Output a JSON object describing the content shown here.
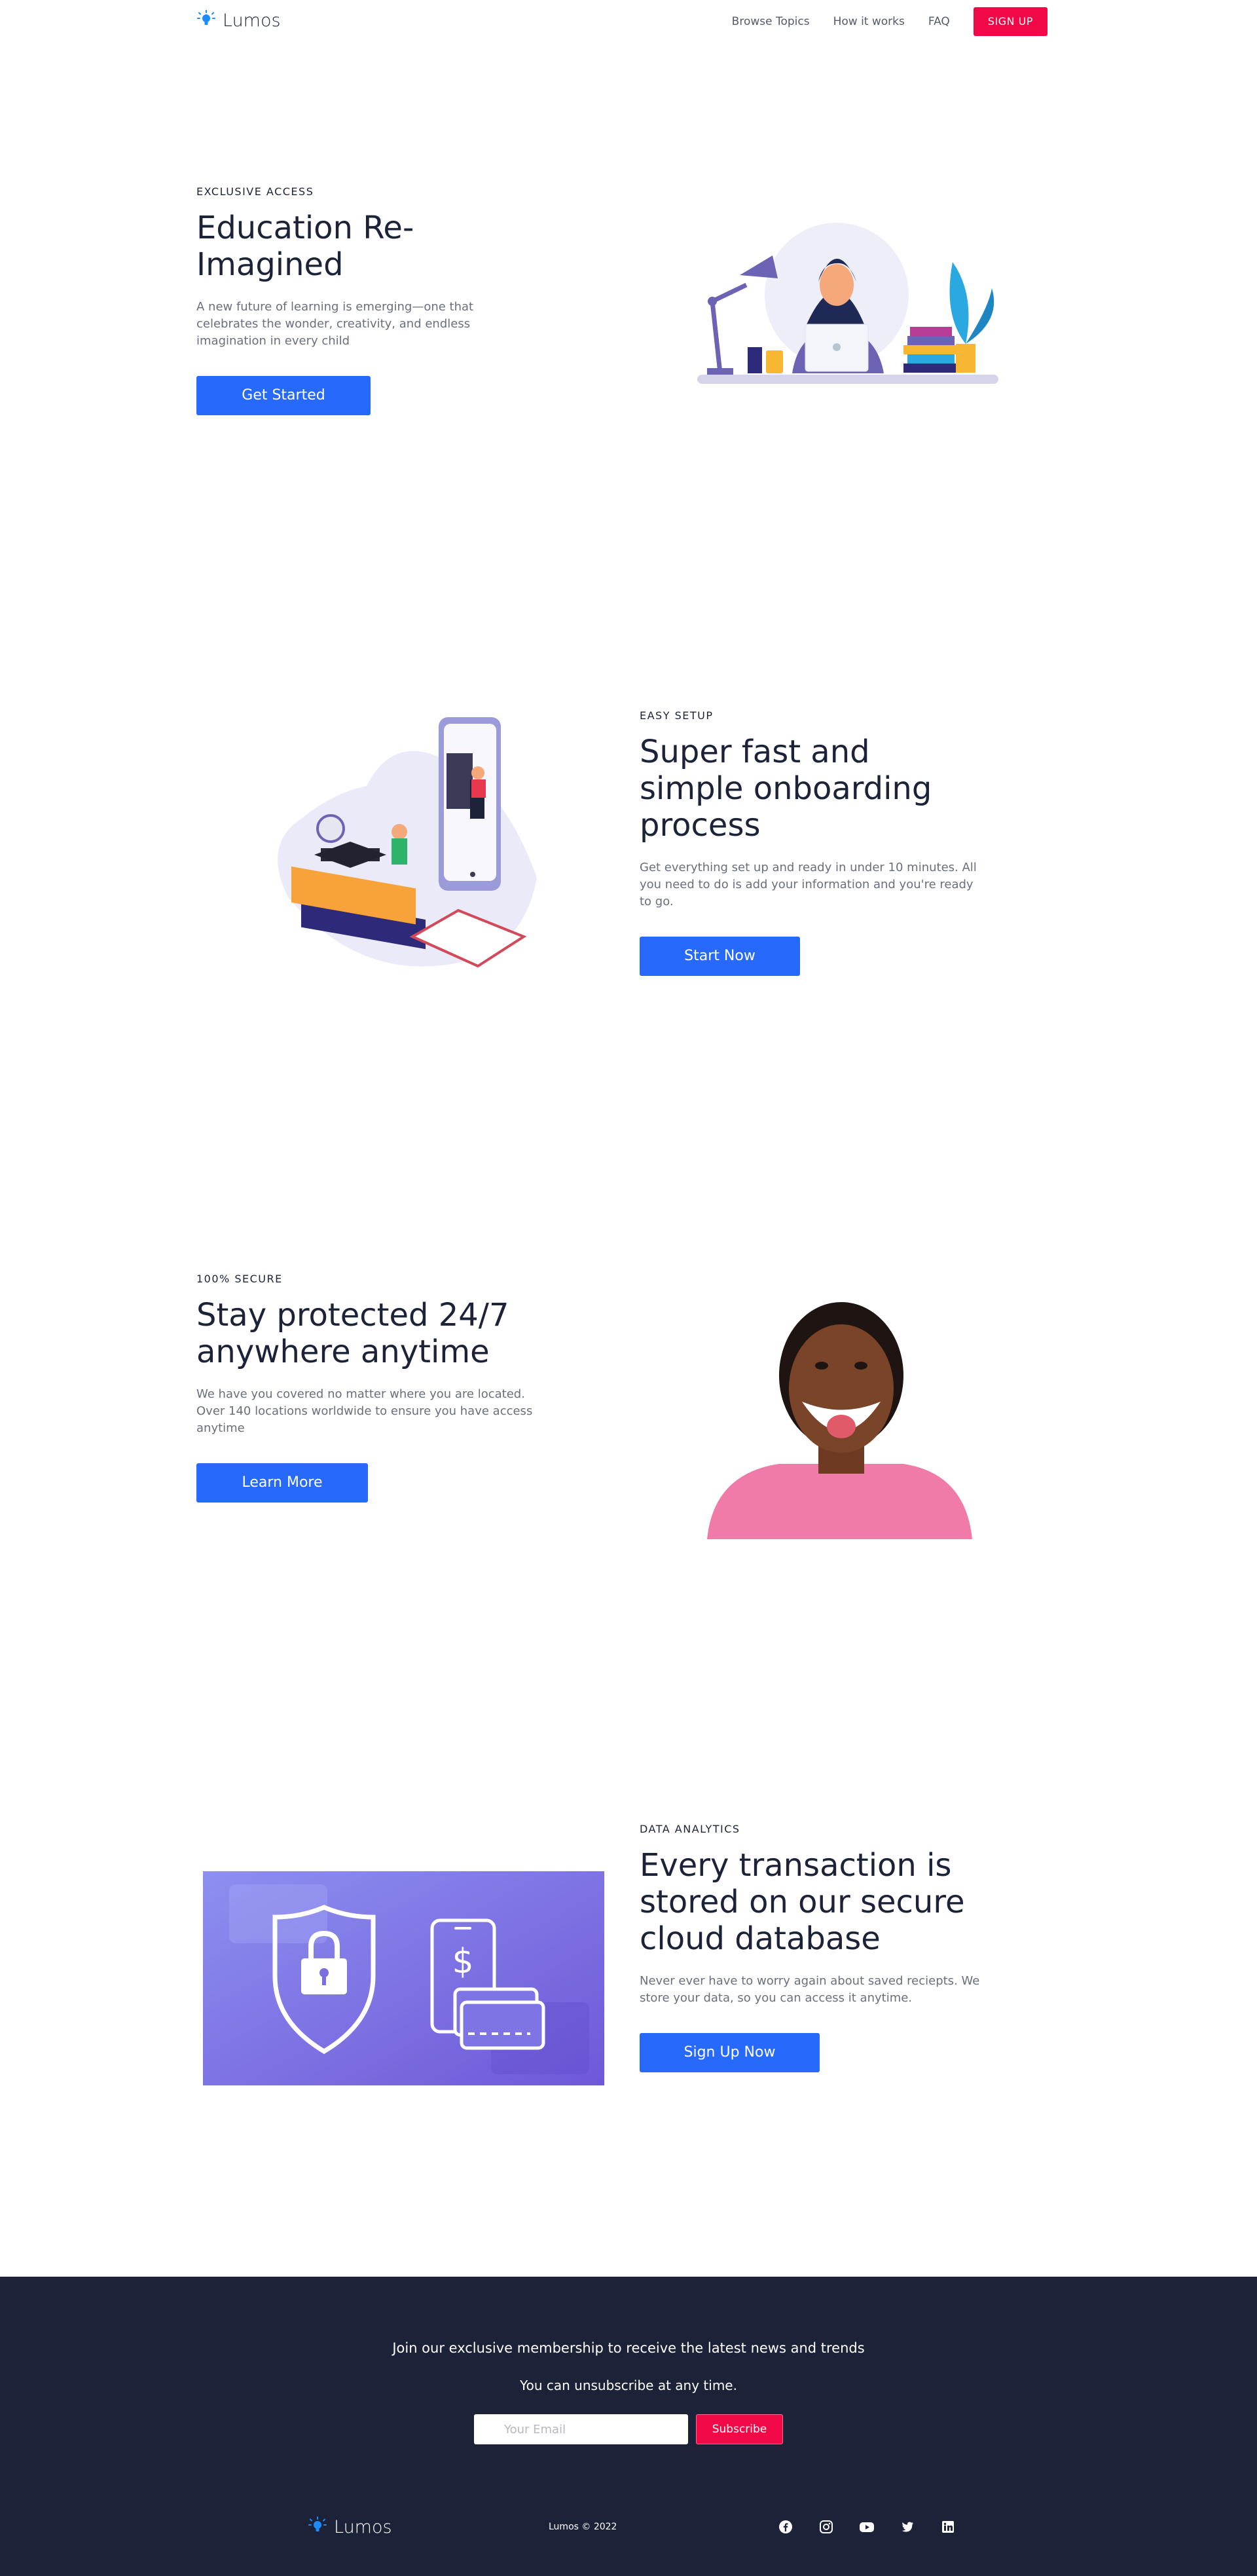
{
  "nav": {
    "brand": "Lumos",
    "links": [
      "Browse Topics",
      "How it works",
      "FAQ"
    ],
    "cta": "SIGN UP"
  },
  "sections": [
    {
      "kicker": "EXCLUSIVE ACCESS",
      "heading": "Education Re-Imagined",
      "description": "A new future of learning is emerging—one that celebrates the wonder, creativity, and endless imagination in every child",
      "button": "Get Started",
      "image": "woman-laptop-illustration"
    },
    {
      "kicker": "EASY SETUP",
      "heading": "Super fast and simple onboarding process",
      "description": "Get everything set up and ready in under 10 minutes. All you need to do is add your information and you're ready to go.",
      "button": "Start Now",
      "image": "onboarding-illustration"
    },
    {
      "kicker": "100% SECURE",
      "heading": "Stay protected 24/7 anywhere anytime",
      "description": "We have you covered no matter where you are located. Over 140 locations worldwide to ensure you have access anytime",
      "button": "Learn More",
      "image": "smiling-girl-photo"
    },
    {
      "kicker": "DATA ANALYTICS",
      "heading": "Every transaction is stored on our secure cloud database",
      "description": "Never ever have to worry again about saved reciepts. We store your data, so you can access it anytime.",
      "button": "Sign Up Now",
      "image": "security-shield-phone-image"
    }
  ],
  "footer": {
    "subscribe_heading": "Join our exclusive membership to receive the latest news and trends",
    "subscribe_text": "You can unsubscribe at any time.",
    "email_placeholder": "Your Email",
    "subscribe_button": "Subscribe",
    "brand": "Lumos",
    "copyright": "Lumos © 2022",
    "social": [
      "facebook-icon",
      "instagram-icon",
      "youtube-icon",
      "twitter-icon",
      "linkedin-icon"
    ]
  },
  "colors": {
    "primary_blue": "#276afb",
    "accent_red": "#f00946",
    "dark_navy": "#1c2237"
  }
}
